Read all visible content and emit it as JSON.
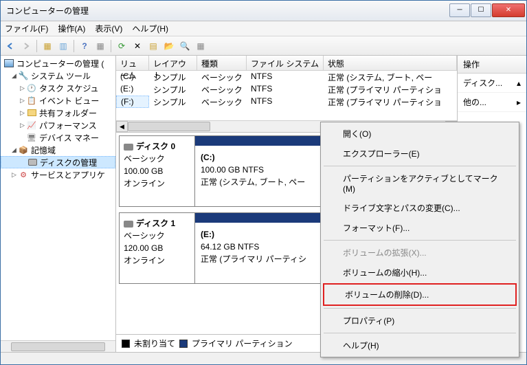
{
  "window": {
    "title": "コンピューターの管理"
  },
  "menu": {
    "file": "ファイル(F)",
    "action": "操作(A)",
    "view": "表示(V)",
    "help": "ヘルプ(H)"
  },
  "tree": {
    "root": "コンピューターの管理 (",
    "systools": "システム ツール",
    "sched": "タスク スケジュ",
    "event": "イベント ビュー",
    "shared": "共有フォルダー",
    "perf": "パフォーマンス",
    "devmgr": "デバイス マネー",
    "storage": "記憶域",
    "diskmgr": "ディスクの管理",
    "services": "サービスとアプリケ"
  },
  "list": {
    "hdr_volume": "リューム",
    "hdr_layout": "レイアウト",
    "hdr_type": "種類",
    "hdr_fs": "ファイル システム",
    "hdr_status": "状態",
    "rows": [
      {
        "vol": "(C:)",
        "layout": "シンプル",
        "type": "ベーシック",
        "fs": "NTFS",
        "status": "正常 (システム, ブート, ペー"
      },
      {
        "vol": "(E:)",
        "layout": "シンプル",
        "type": "ベーシック",
        "fs": "NTFS",
        "status": "正常 (プライマリ パーティショ"
      },
      {
        "vol": "(F:)",
        "layout": "シンプル",
        "type": "ベーシック",
        "fs": "NTFS",
        "status": "正常 (プライマリ パーティショ"
      }
    ]
  },
  "disks": [
    {
      "name": "ディスク 0",
      "type": "ベーシック",
      "size": "100.00 GB",
      "status": "オンライン",
      "vol_letter": "(C:)",
      "vol_size": "100.00 GB NTFS",
      "vol_status": "正常 (システム, ブート, ペー"
    },
    {
      "name": "ディスク 1",
      "type": "ベーシック",
      "size": "120.00 GB",
      "status": "オンライン",
      "vol_letter": "(E:)",
      "vol_size": "64.12 GB NTFS",
      "vol_status": "正常 (プライマリ パーティシ"
    }
  ],
  "legend": {
    "unalloc": "未割り当て",
    "primary": "プライマリ パーティション"
  },
  "actions": {
    "hdr": "操作",
    "disk": "ディスク...",
    "other": "他の..."
  },
  "ctx": {
    "open": "開く(O)",
    "explorer": "エクスプローラー(E)",
    "active": "パーティションをアクティブとしてマーク(M)",
    "drive": "ドライブ文字とパスの変更(C)...",
    "format": "フォーマット(F)...",
    "extend": "ボリュームの拡張(X)...",
    "shrink": "ボリュームの縮小(H)...",
    "delete": "ボリュームの削除(D)...",
    "prop": "プロパティ(P)",
    "help": "ヘルプ(H)"
  }
}
